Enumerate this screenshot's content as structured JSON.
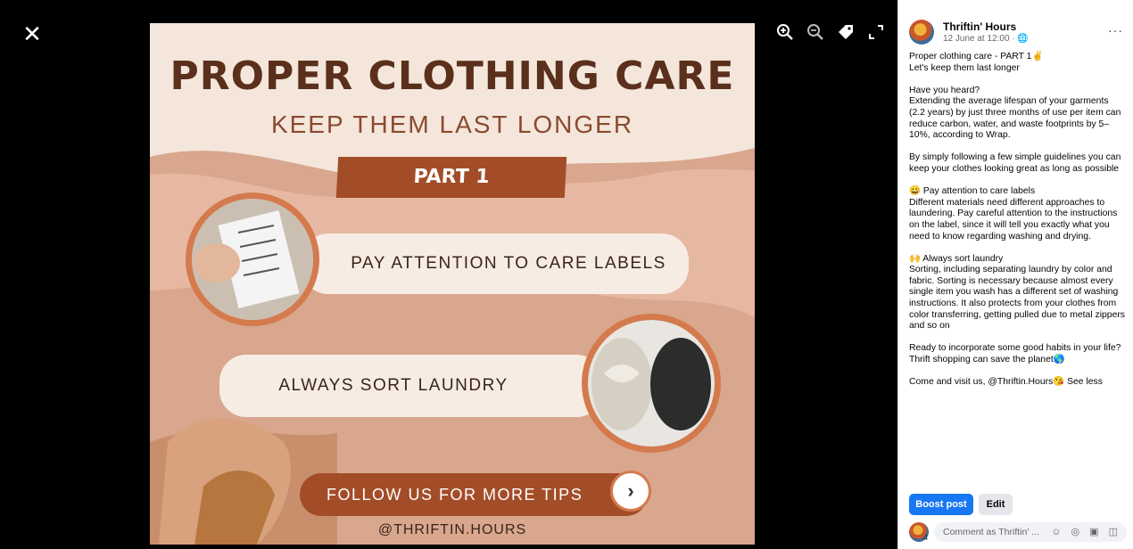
{
  "viewer": {
    "close_icon": "close-icon",
    "tools": [
      "zoom-in-icon",
      "zoom-out-icon",
      "tag-icon",
      "fullscreen-icon"
    ]
  },
  "poster": {
    "title": "PROPER CLOTHING CARE",
    "subtitle": "KEEP THEM LAST LONGER",
    "part": "PART 1",
    "tip1": "PAY ATTENTION TO CARE LABELS",
    "tip2": "ALWAYS SORT LAUNDRY",
    "follow": "FOLLOW US FOR MORE TIPS",
    "arrow": "›",
    "handle": "@THRIFTIN.HOURS",
    "colors": {
      "bg": "#f4e6da",
      "accent": "#a34d28",
      "ring": "#d47a4d",
      "title": "#5a2f1b"
    }
  },
  "post": {
    "page_name": "Thriftin' Hours",
    "meta": "12 June at 12:00 · 🌐",
    "more": "···",
    "body": "Proper clothing care - PART 1✌\nLet's keep them last longer\n\nHave you heard?\nExtending the average lifespan of your garments (2.2 years) by just three months of use per item can reduce carbon, water, and waste footprints by 5–10%, according to Wrap.\n\nBy simply following a few simple guidelines you can keep your clothes looking great as long as possible\n\n😀 Pay attention to care labels\nDifferent materials need different approaches to laundering. Pay careful attention to the instructions on the label, since it will tell you exactly what you need to know regarding washing and drying.\n\n🙌 Always sort laundry\nSorting, including separating laundry by color and fabric. Sorting is necessary because almost every single item you wash has a different set of washing instructions. It also protects from your clothes from color transferring, getting pulled due to metal zippers and so on\n\nReady to incorporate some good habits in your life?\nThrift shopping can save the planet🌎\n\nCome and visit us, @Thriftin.Hours😘 See less",
    "boost_label": "Boost post",
    "edit_label": "Edit",
    "comment_placeholder": "Comment as Thriftin' ...",
    "comment_badge": "4",
    "comment_icons": "☺ ◎ ▣ ◫"
  }
}
